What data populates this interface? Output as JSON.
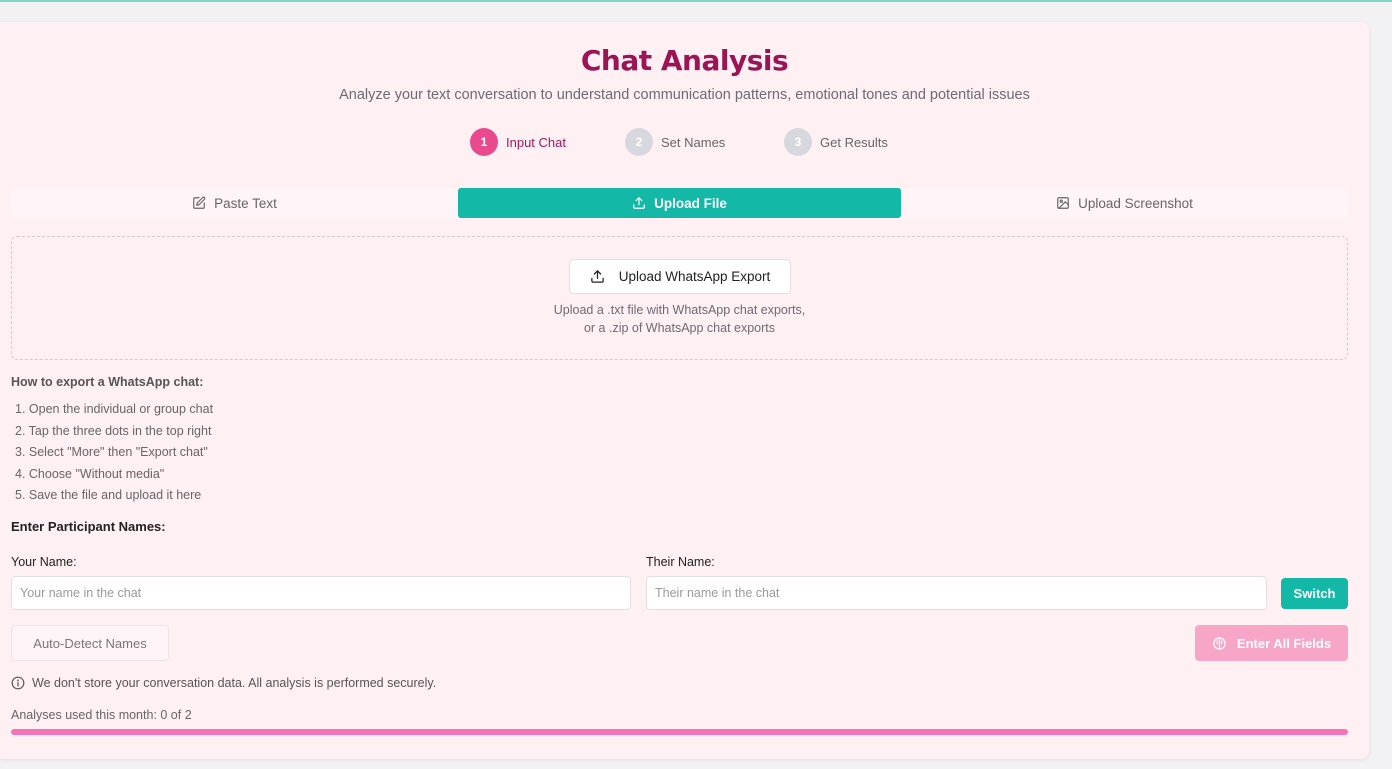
{
  "header": {
    "title": "Chat Analysis",
    "subtitle": "Analyze your text conversation to understand communication patterns, emotional tones and potential issues"
  },
  "steps": [
    {
      "number": "1",
      "label": "Input Chat",
      "active": true
    },
    {
      "number": "2",
      "label": "Set Names",
      "active": false
    },
    {
      "number": "3",
      "label": "Get Results",
      "active": false
    }
  ],
  "tabs": [
    {
      "label": "Paste Text",
      "icon": "edit-icon",
      "active": false
    },
    {
      "label": "Upload File",
      "icon": "upload-icon",
      "active": true
    },
    {
      "label": "Upload Screenshot",
      "icon": "image-icon",
      "active": false
    }
  ],
  "upload": {
    "button_label": "Upload WhatsApp Export",
    "hint_line1": "Upload a .txt file with WhatsApp chat exports,",
    "hint_line2": "or a .zip of WhatsApp chat exports"
  },
  "howto": {
    "title": "How to export a WhatsApp chat:",
    "steps": [
      "1. Open the individual or group chat",
      "2. Tap the three dots in the top right",
      "3. Select \"More\" then \"Export chat\"",
      "4. Choose \"Without media\"",
      "5. Save the file and upload it here"
    ]
  },
  "participants": {
    "title": "Enter Participant Names:",
    "your_name_label": "Your Name:",
    "your_name_placeholder": "Your name in the chat",
    "your_name_value": "",
    "their_name_label": "Their Name:",
    "their_name_placeholder": "Their name in the chat",
    "their_name_value": "",
    "switch_label": "Switch"
  },
  "actions": {
    "auto_detect_label": "Auto-Detect Names",
    "analyze_label": "Enter All Fields"
  },
  "privacy_note": "We don't store your conversation data. All analysis is performed securely.",
  "usage": {
    "text": "Analyses used this month: 0 of 2",
    "progress_fraction": 1.0
  },
  "colors": {
    "brand_title": "#9b1454",
    "accent_teal": "#14b8a6",
    "accent_pink": "#e94a8d",
    "progress_pink": "#f472b6",
    "disabled_pink": "#f7a6c8",
    "card_bg": "#fff0f4"
  }
}
